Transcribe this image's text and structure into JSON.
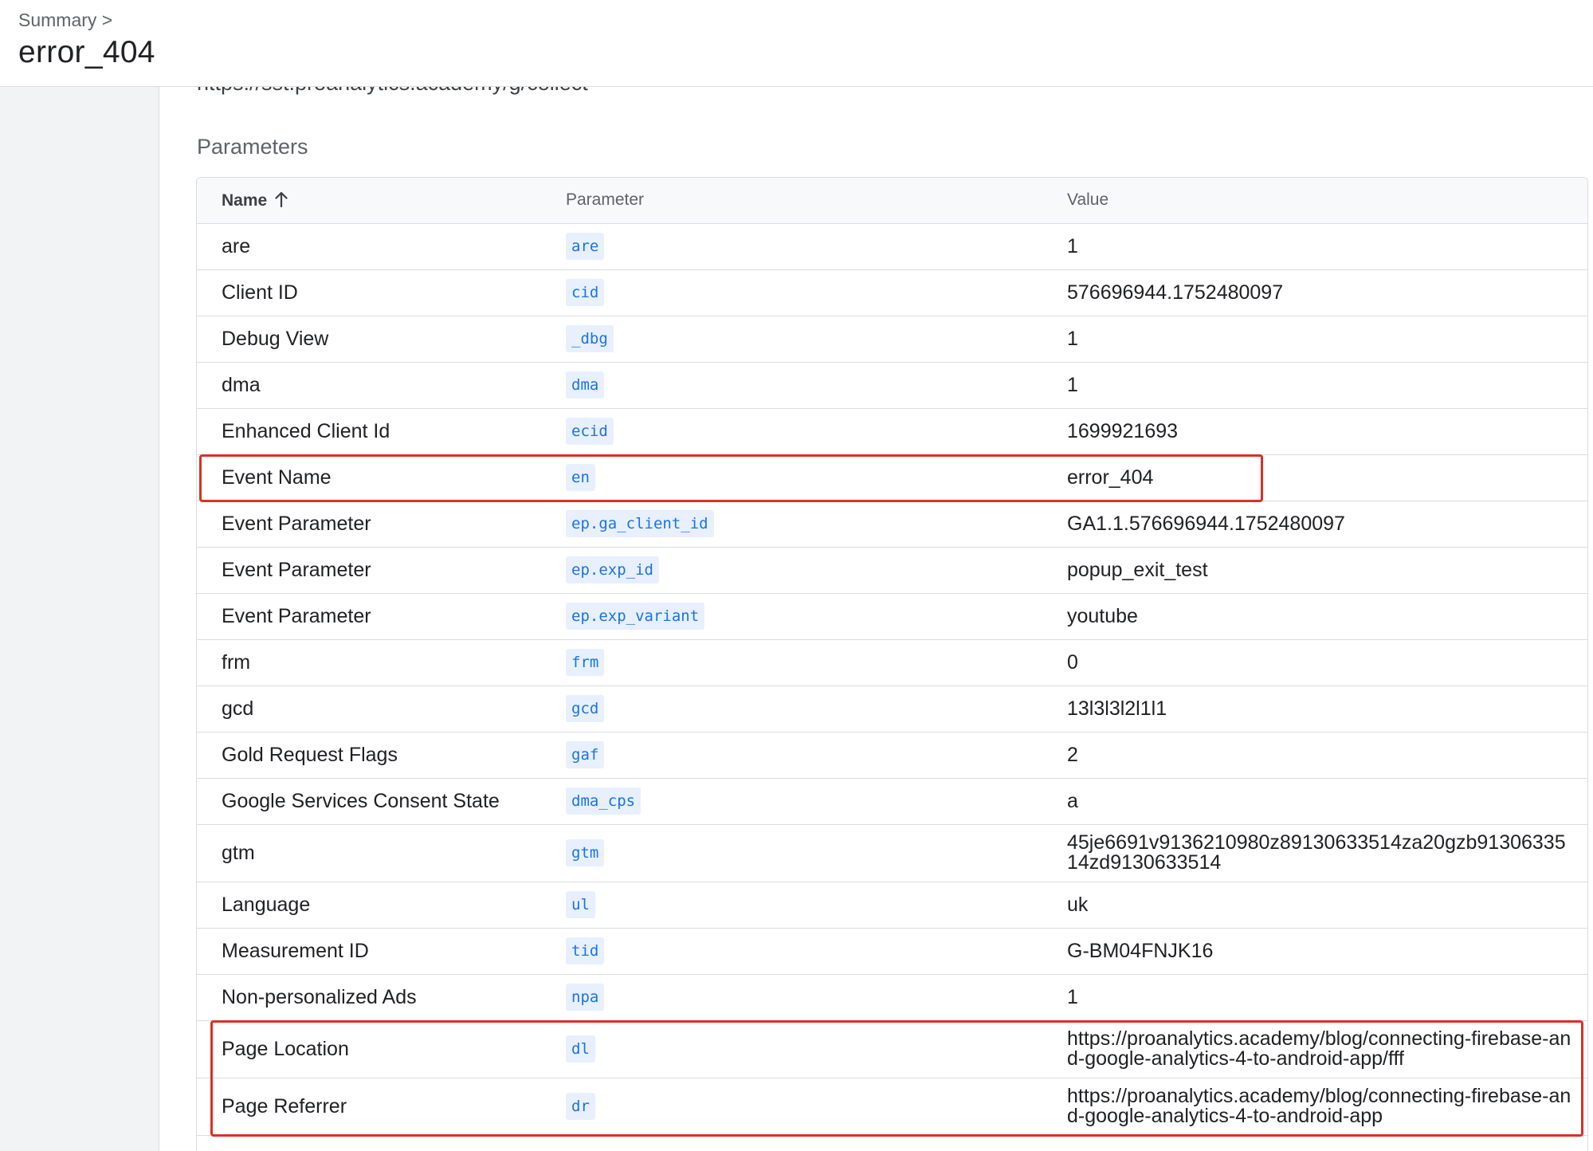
{
  "header": {
    "breadcrumb": "Summary >",
    "title": "error_404"
  },
  "main": {
    "url": "https://sst.proanalytics.academy/g/collect",
    "section_title": "Parameters",
    "table": {
      "columns": {
        "name": "Name",
        "parameter": "Parameter",
        "value": "Value"
      },
      "rows": [
        {
          "name": "are",
          "param": "are",
          "value": "1"
        },
        {
          "name": "Client ID",
          "param": "cid",
          "value": "576696944.1752480097"
        },
        {
          "name": "Debug View",
          "param": "_dbg",
          "value": "1"
        },
        {
          "name": "dma",
          "param": "dma",
          "value": "1"
        },
        {
          "name": "Enhanced Client Id",
          "param": "ecid",
          "value": "1699921693"
        },
        {
          "name": "Event Name",
          "param": "en",
          "value": "error_404"
        },
        {
          "name": "Event Parameter",
          "param": "ep.ga_client_id",
          "value": "GA1.1.576696944.1752480097"
        },
        {
          "name": "Event Parameter",
          "param": "ep.exp_id",
          "value": "popup_exit_test"
        },
        {
          "name": "Event Parameter",
          "param": "ep.exp_variant",
          "value": "youtube"
        },
        {
          "name": "frm",
          "param": "frm",
          "value": "0"
        },
        {
          "name": "gcd",
          "param": "gcd",
          "value": "13l3l3l2l1l1"
        },
        {
          "name": "Gold Request Flags",
          "param": "gaf",
          "value": "2"
        },
        {
          "name": "Google Services Consent State",
          "param": "dma_cps",
          "value": "a"
        },
        {
          "name": "gtm",
          "param": "gtm",
          "value": "45je6691v9136210980z89130633514za20gzb9130633514zd9130633514"
        },
        {
          "name": "Language",
          "param": "ul",
          "value": "uk"
        },
        {
          "name": "Measurement ID",
          "param": "tid",
          "value": "G-BM04FNJK16"
        },
        {
          "name": "Non-personalized Ads",
          "param": "npa",
          "value": "1"
        },
        {
          "name": "Page Location",
          "param": "dl",
          "value": "https://proanalytics.academy/blog/connecting-firebase-and-google-analytics-4-to-android-app/fff"
        },
        {
          "name": "Page Referrer",
          "param": "dr",
          "value": "https://proanalytics.academy/blog/connecting-firebase-and-google-analytics-4-to-android-app"
        }
      ]
    }
  },
  "colors": {
    "accent": "#1a73e8",
    "code_bg": "#e8f0fe",
    "highlight": "#d93025",
    "sidebar_bg": "#f1f3f4",
    "border": "#dadce0"
  },
  "icons": {
    "sort": "arrow-up-icon"
  }
}
